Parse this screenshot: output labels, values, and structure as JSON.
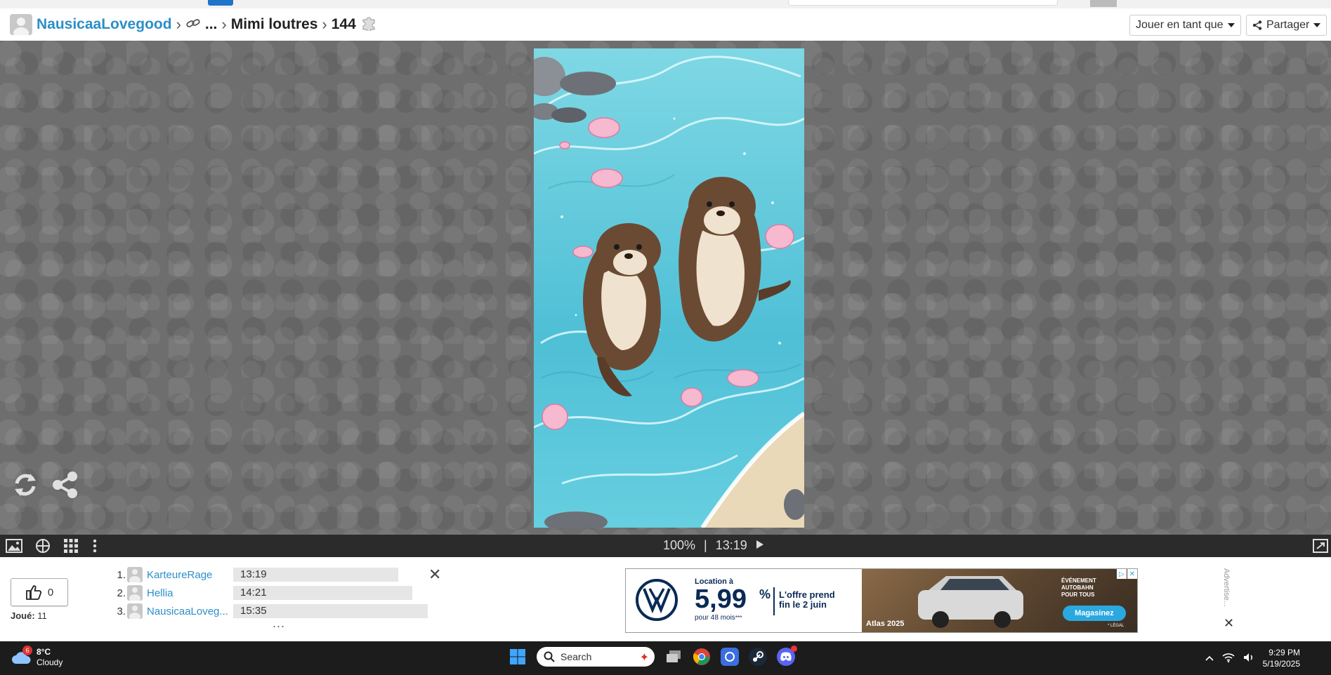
{
  "header": {
    "user": "NausicaaLovegood",
    "ellipsis": "...",
    "album": "Mimi loutres",
    "piece_count": "144",
    "play_as_label": "Jouer en tant que",
    "share_label": "Partager"
  },
  "game": {
    "zoom": "100%",
    "divider": "|",
    "timer": "13:19"
  },
  "panel": {
    "likes": "0",
    "played_label": "Joué:",
    "played_count": "11",
    "leaderboard": [
      {
        "rank": "1.",
        "name": "KarteureRage",
        "time": "13:19",
        "bar": 230
      },
      {
        "rank": "2.",
        "name": "Hellia",
        "time": "14:21",
        "bar": 250
      },
      {
        "rank": "3.",
        "name": "NausicaaLoveg...",
        "time": "15:35",
        "bar": 272
      }
    ],
    "more": "...",
    "ad_side_label": "Advertise..."
  },
  "ad": {
    "location_label": "Location à",
    "price_big": "5,99",
    "price_pct": "%",
    "price_term": "pour 48 mois",
    "price_term_mark": "***",
    "offer_line1": "L'offre prend",
    "offer_line2": "fin le 2 juin",
    "badge_line1": "ÉVÉNEMENT",
    "badge_line2": "AUTOBAHN",
    "badge_line3": "POUR TOUS",
    "model": "Atlas 2025",
    "cta": "Magasinez",
    "legal": "* LÉGAL"
  },
  "taskbar": {
    "weather_badge": "6",
    "temp": "8°C",
    "condition": "Cloudy",
    "search_placeholder": "Search",
    "time": "9:29 PM",
    "date": "5/19/2025"
  },
  "colors": {
    "link": "#2b8fc7",
    "stage_bg": "#6e6e6e",
    "bottombar": "#2b2b2b",
    "taskbar": "#1c1c1c",
    "water": "#5fc6d8",
    "otter": "#6b4a33"
  }
}
